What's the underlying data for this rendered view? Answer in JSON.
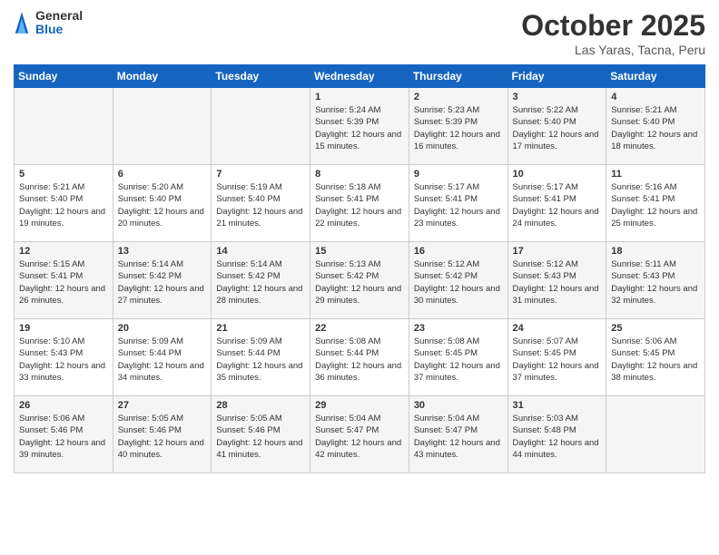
{
  "header": {
    "logo_general": "General",
    "logo_blue": "Blue",
    "month_year": "October 2025",
    "location": "Las Yaras, Tacna, Peru"
  },
  "weekdays": [
    "Sunday",
    "Monday",
    "Tuesday",
    "Wednesday",
    "Thursday",
    "Friday",
    "Saturday"
  ],
  "weeks": [
    [
      {
        "day": "",
        "sunrise": "",
        "sunset": "",
        "daylight": ""
      },
      {
        "day": "",
        "sunrise": "",
        "sunset": "",
        "daylight": ""
      },
      {
        "day": "",
        "sunrise": "",
        "sunset": "",
        "daylight": ""
      },
      {
        "day": "1",
        "sunrise": "Sunrise: 5:24 AM",
        "sunset": "Sunset: 5:39 PM",
        "daylight": "Daylight: 12 hours and 15 minutes."
      },
      {
        "day": "2",
        "sunrise": "Sunrise: 5:23 AM",
        "sunset": "Sunset: 5:39 PM",
        "daylight": "Daylight: 12 hours and 16 minutes."
      },
      {
        "day": "3",
        "sunrise": "Sunrise: 5:22 AM",
        "sunset": "Sunset: 5:40 PM",
        "daylight": "Daylight: 12 hours and 17 minutes."
      },
      {
        "day": "4",
        "sunrise": "Sunrise: 5:21 AM",
        "sunset": "Sunset: 5:40 PM",
        "daylight": "Daylight: 12 hours and 18 minutes."
      }
    ],
    [
      {
        "day": "5",
        "sunrise": "Sunrise: 5:21 AM",
        "sunset": "Sunset: 5:40 PM",
        "daylight": "Daylight: 12 hours and 19 minutes."
      },
      {
        "day": "6",
        "sunrise": "Sunrise: 5:20 AM",
        "sunset": "Sunset: 5:40 PM",
        "daylight": "Daylight: 12 hours and 20 minutes."
      },
      {
        "day": "7",
        "sunrise": "Sunrise: 5:19 AM",
        "sunset": "Sunset: 5:40 PM",
        "daylight": "Daylight: 12 hours and 21 minutes."
      },
      {
        "day": "8",
        "sunrise": "Sunrise: 5:18 AM",
        "sunset": "Sunset: 5:41 PM",
        "daylight": "Daylight: 12 hours and 22 minutes."
      },
      {
        "day": "9",
        "sunrise": "Sunrise: 5:17 AM",
        "sunset": "Sunset: 5:41 PM",
        "daylight": "Daylight: 12 hours and 23 minutes."
      },
      {
        "day": "10",
        "sunrise": "Sunrise: 5:17 AM",
        "sunset": "Sunset: 5:41 PM",
        "daylight": "Daylight: 12 hours and 24 minutes."
      },
      {
        "day": "11",
        "sunrise": "Sunrise: 5:16 AM",
        "sunset": "Sunset: 5:41 PM",
        "daylight": "Daylight: 12 hours and 25 minutes."
      }
    ],
    [
      {
        "day": "12",
        "sunrise": "Sunrise: 5:15 AM",
        "sunset": "Sunset: 5:41 PM",
        "daylight": "Daylight: 12 hours and 26 minutes."
      },
      {
        "day": "13",
        "sunrise": "Sunrise: 5:14 AM",
        "sunset": "Sunset: 5:42 PM",
        "daylight": "Daylight: 12 hours and 27 minutes."
      },
      {
        "day": "14",
        "sunrise": "Sunrise: 5:14 AM",
        "sunset": "Sunset: 5:42 PM",
        "daylight": "Daylight: 12 hours and 28 minutes."
      },
      {
        "day": "15",
        "sunrise": "Sunrise: 5:13 AM",
        "sunset": "Sunset: 5:42 PM",
        "daylight": "Daylight: 12 hours and 29 minutes."
      },
      {
        "day": "16",
        "sunrise": "Sunrise: 5:12 AM",
        "sunset": "Sunset: 5:42 PM",
        "daylight": "Daylight: 12 hours and 30 minutes."
      },
      {
        "day": "17",
        "sunrise": "Sunrise: 5:12 AM",
        "sunset": "Sunset: 5:43 PM",
        "daylight": "Daylight: 12 hours and 31 minutes."
      },
      {
        "day": "18",
        "sunrise": "Sunrise: 5:11 AM",
        "sunset": "Sunset: 5:43 PM",
        "daylight": "Daylight: 12 hours and 32 minutes."
      }
    ],
    [
      {
        "day": "19",
        "sunrise": "Sunrise: 5:10 AM",
        "sunset": "Sunset: 5:43 PM",
        "daylight": "Daylight: 12 hours and 33 minutes."
      },
      {
        "day": "20",
        "sunrise": "Sunrise: 5:09 AM",
        "sunset": "Sunset: 5:44 PM",
        "daylight": "Daylight: 12 hours and 34 minutes."
      },
      {
        "day": "21",
        "sunrise": "Sunrise: 5:09 AM",
        "sunset": "Sunset: 5:44 PM",
        "daylight": "Daylight: 12 hours and 35 minutes."
      },
      {
        "day": "22",
        "sunrise": "Sunrise: 5:08 AM",
        "sunset": "Sunset: 5:44 PM",
        "daylight": "Daylight: 12 hours and 36 minutes."
      },
      {
        "day": "23",
        "sunrise": "Sunrise: 5:08 AM",
        "sunset": "Sunset: 5:45 PM",
        "daylight": "Daylight: 12 hours and 37 minutes."
      },
      {
        "day": "24",
        "sunrise": "Sunrise: 5:07 AM",
        "sunset": "Sunset: 5:45 PM",
        "daylight": "Daylight: 12 hours and 37 minutes."
      },
      {
        "day": "25",
        "sunrise": "Sunrise: 5:06 AM",
        "sunset": "Sunset: 5:45 PM",
        "daylight": "Daylight: 12 hours and 38 minutes."
      }
    ],
    [
      {
        "day": "26",
        "sunrise": "Sunrise: 5:06 AM",
        "sunset": "Sunset: 5:46 PM",
        "daylight": "Daylight: 12 hours and 39 minutes."
      },
      {
        "day": "27",
        "sunrise": "Sunrise: 5:05 AM",
        "sunset": "Sunset: 5:46 PM",
        "daylight": "Daylight: 12 hours and 40 minutes."
      },
      {
        "day": "28",
        "sunrise": "Sunrise: 5:05 AM",
        "sunset": "Sunset: 5:46 PM",
        "daylight": "Daylight: 12 hours and 41 minutes."
      },
      {
        "day": "29",
        "sunrise": "Sunrise: 5:04 AM",
        "sunset": "Sunset: 5:47 PM",
        "daylight": "Daylight: 12 hours and 42 minutes."
      },
      {
        "day": "30",
        "sunrise": "Sunrise: 5:04 AM",
        "sunset": "Sunset: 5:47 PM",
        "daylight": "Daylight: 12 hours and 43 minutes."
      },
      {
        "day": "31",
        "sunrise": "Sunrise: 5:03 AM",
        "sunset": "Sunset: 5:48 PM",
        "daylight": "Daylight: 12 hours and 44 minutes."
      },
      {
        "day": "",
        "sunrise": "",
        "sunset": "",
        "daylight": ""
      }
    ]
  ]
}
